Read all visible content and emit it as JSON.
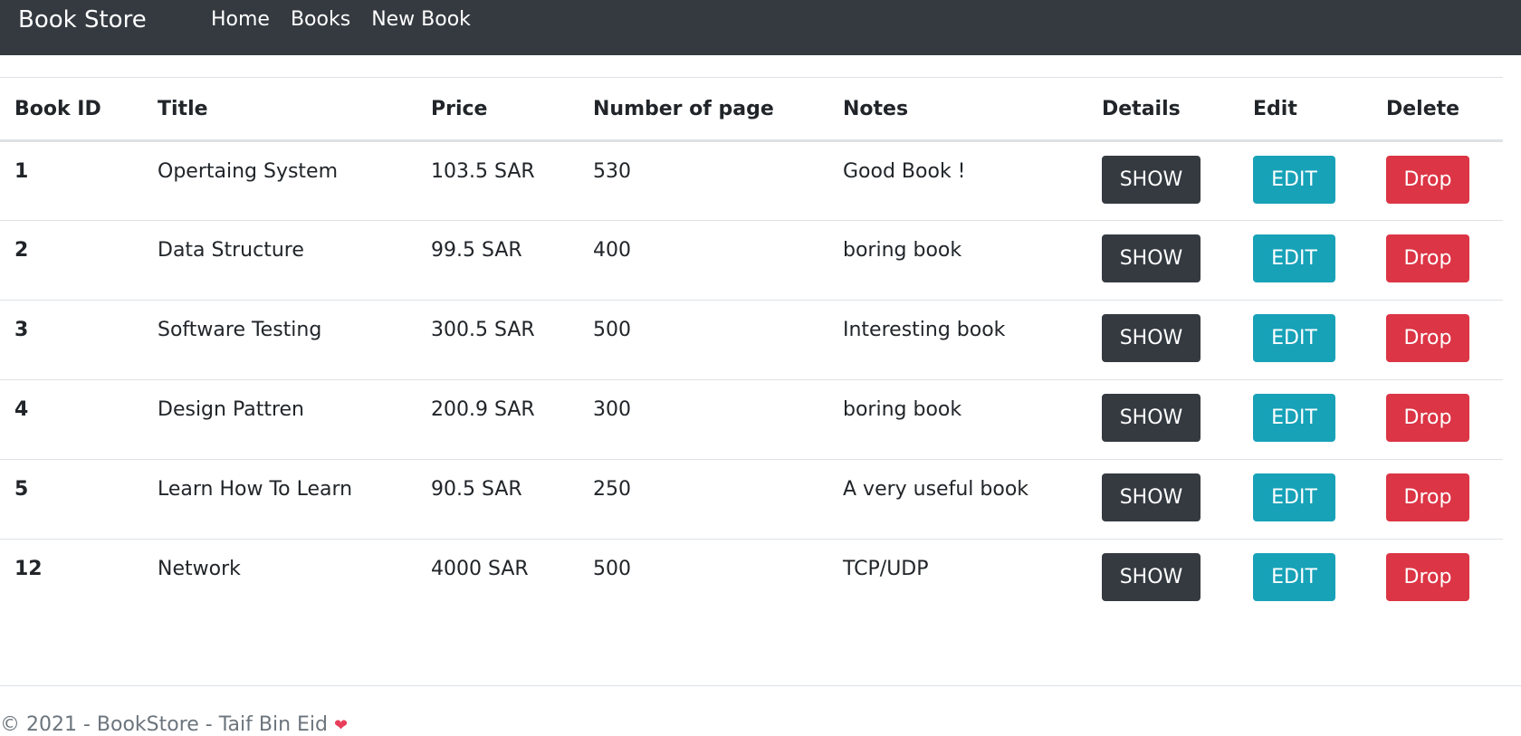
{
  "navbar": {
    "brand": "Book Store",
    "links": [
      "Home",
      "Books",
      "New Book"
    ]
  },
  "table": {
    "headers": [
      "Book ID",
      "Title",
      "Price",
      "Number of page",
      "Notes",
      "Details",
      "Edit",
      "Delete"
    ],
    "rows": [
      {
        "id": "1",
        "title": "Opertaing System",
        "price": "103.5 SAR",
        "pages": "530",
        "notes": "Good Book !",
        "show": "SHOW",
        "edit": "EDIT",
        "drop": "Drop"
      },
      {
        "id": "2",
        "title": "Data Structure",
        "price": "99.5 SAR",
        "pages": "400",
        "notes": "boring book",
        "show": "SHOW",
        "edit": "EDIT",
        "drop": "Drop"
      },
      {
        "id": "3",
        "title": "Software Testing",
        "price": "300.5 SAR",
        "pages": "500",
        "notes": "Interesting book",
        "show": "SHOW",
        "edit": "EDIT",
        "drop": "Drop"
      },
      {
        "id": "4",
        "title": "Design Pattren",
        "price": "200.9 SAR",
        "pages": "300",
        "notes": "boring book",
        "show": "SHOW",
        "edit": "EDIT",
        "drop": "Drop"
      },
      {
        "id": "5",
        "title": "Learn How To Learn",
        "price": "90.5 SAR",
        "pages": "250",
        "notes": "A very useful book",
        "show": "SHOW",
        "edit": "EDIT",
        "drop": "Drop"
      },
      {
        "id": "12",
        "title": "Network",
        "price": "4000 SAR",
        "pages": "500",
        "notes": "TCP/UDP",
        "show": "SHOW",
        "edit": "EDIT",
        "drop": "Drop"
      }
    ]
  },
  "footer": {
    "text": "© 2021 - BookStore - Taif Bin Eid",
    "heart_icon": "heart-icon",
    "heart_glyph": "❤"
  },
  "colors": {
    "navbar_bg": "#343a40",
    "show_button": "#343a40",
    "edit_button": "#17a2b8",
    "drop_button": "#dc3545"
  }
}
